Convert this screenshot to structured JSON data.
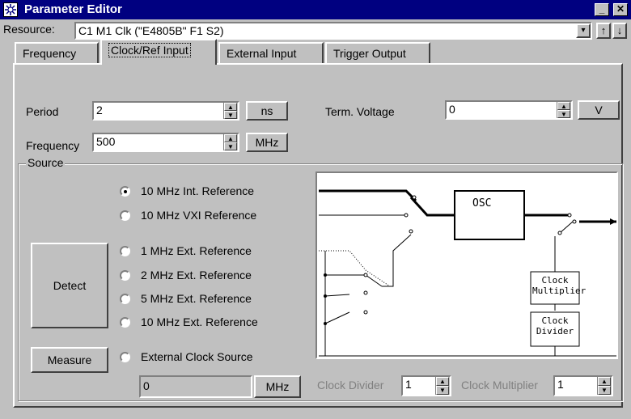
{
  "window": {
    "title": "Parameter Editor",
    "minimize": "_",
    "close": "✕"
  },
  "resource": {
    "label": "Resource:",
    "value": "C1 M1 Clk (\"E4805B\" F1 S2)",
    "dropdown": "▾",
    "up": "↑",
    "down": "↓"
  },
  "tabs": [
    {
      "label": "Frequency"
    },
    {
      "label": "Clock/Ref Input"
    },
    {
      "label": "External Input"
    },
    {
      "label": "Trigger Output"
    }
  ],
  "period": {
    "label": "Period",
    "value": "2",
    "unit": "ns"
  },
  "frequency": {
    "label": "Frequency",
    "value": "500",
    "unit": "MHz"
  },
  "term_voltage": {
    "label": "Term. Voltage",
    "value": "0",
    "unit": "V"
  },
  "source": {
    "label": "Source",
    "options": [
      {
        "label": "10 MHz Int. Reference",
        "selected": true
      },
      {
        "label": "10 MHz VXI Reference",
        "selected": false
      },
      {
        "label": "1 MHz Ext. Reference",
        "selected": false
      },
      {
        "label": "2 MHz Ext. Reference",
        "selected": false
      },
      {
        "label": "5 MHz Ext. Reference",
        "selected": false
      },
      {
        "label": "10 MHz Ext. Reference",
        "selected": false
      },
      {
        "label": "External Clock Source",
        "selected": false
      }
    ],
    "detect": "Detect",
    "measure": "Measure",
    "ext_clock_value": "0",
    "ext_clock_unit": "MHz"
  },
  "diagram": {
    "osc": "OSC",
    "clock_multiplier": "Clock Multiplier",
    "clock_divider": "Clock Divider"
  },
  "clock_divider": {
    "label": "Clock Divider",
    "value": "1"
  },
  "clock_multiplier": {
    "label": "Clock Multiplier",
    "value": "1"
  }
}
